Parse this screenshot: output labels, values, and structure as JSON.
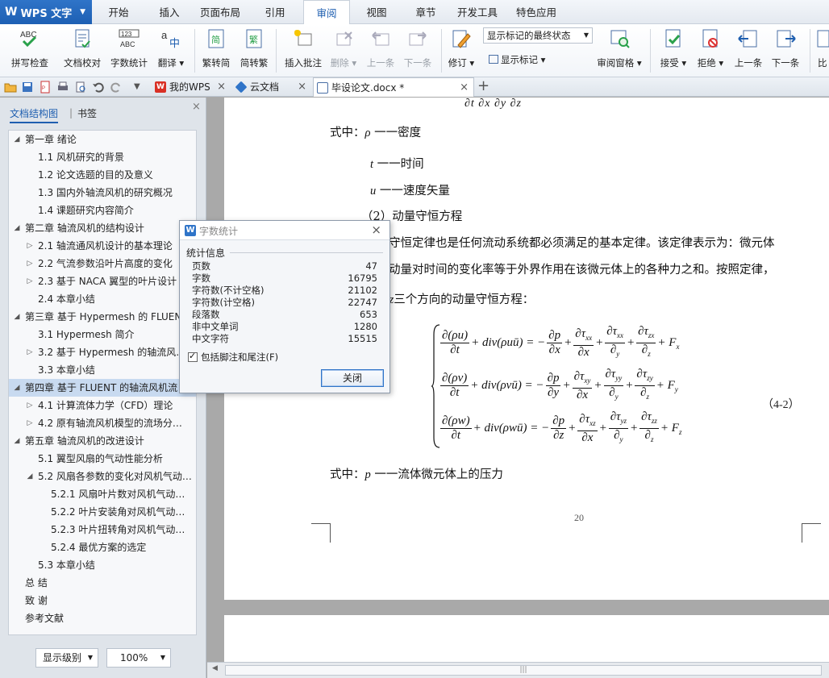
{
  "app": {
    "name": "WPS 文字"
  },
  "menu": {
    "tabs": [
      "开始",
      "插入",
      "页面布局",
      "引用",
      "审阅",
      "视图",
      "章节",
      "开发工具",
      "特色应用"
    ],
    "active": "审阅"
  },
  "ribbon": {
    "spell": "拼写检查",
    "proof": "文档校对",
    "wordcount": "字数统计",
    "translate": "翻译",
    "t2s": "繁转简",
    "s2t": "简转繁",
    "insert_comment": "插入批注",
    "delete": "删除",
    "prev": "上一条",
    "next": "下一条",
    "revise": "修订",
    "track_select": "显示标记的最终状态",
    "show_markup": "显示标记",
    "review_pane": "审阅窗格",
    "accept": "接受",
    "reject": "拒绝",
    "prev2": "上一条",
    "next2": "下一条",
    "compare": "比"
  },
  "tabs_bar": {
    "tab1": "我的WPS",
    "tab2": "云文档",
    "tab3": "毕设论文.docx *"
  },
  "nav": {
    "tab_outline": "文档结构图",
    "tab_bookmark": "书签",
    "items": [
      {
        "text": "第一章  绪论",
        "level": 0,
        "arrow": "◢"
      },
      {
        "text": "1.1 风机研究的背景",
        "level": 1,
        "arrow": ""
      },
      {
        "text": "1.2 论文选题的目的及意义",
        "level": 1,
        "arrow": ""
      },
      {
        "text": "1.3 国内外轴流风机的研究概况",
        "level": 1,
        "arrow": ""
      },
      {
        "text": "1.4 课题研究内容简介",
        "level": 1,
        "arrow": ""
      },
      {
        "text": "第二章  轴流风机的结构设计",
        "level": 0,
        "arrow": "◢"
      },
      {
        "text": "2.1 轴流通风机设计的基本理论",
        "level": 1,
        "arrow": "▷"
      },
      {
        "text": "2.2 气流参数沿叶片高度的变化",
        "level": 1,
        "arrow": "▷"
      },
      {
        "text": "2.3 基于 NACA 翼型的叶片设计",
        "level": 1,
        "arrow": "▷"
      },
      {
        "text": "2.4 本章小结",
        "level": 1,
        "arrow": ""
      },
      {
        "text": "第三章  基于 Hypermesh 的 FLUENT",
        "level": 0,
        "arrow": "◢"
      },
      {
        "text": "3.1 Hypermesh 简介",
        "level": 1,
        "arrow": ""
      },
      {
        "text": "3.2  基于 Hypermesh 的轴流风…",
        "level": 1,
        "arrow": "▷"
      },
      {
        "text": "3.3  本章小结",
        "level": 1,
        "arrow": ""
      },
      {
        "text": "第四章  基于 FLUENT 的轴流风机流",
        "level": 0,
        "arrow": "◢",
        "selected": true
      },
      {
        "text": "4.1  计算流体力学（CFD）理论",
        "level": 1,
        "arrow": "▷"
      },
      {
        "text": "4.2  原有轴流风机模型的流场分…",
        "level": 1,
        "arrow": "▷"
      },
      {
        "text": "第五章  轴流风机的改进设计",
        "level": 0,
        "arrow": "◢"
      },
      {
        "text": "5.1 翼型风扇的气动性能分析",
        "level": 1,
        "arrow": ""
      },
      {
        "text": "5.2 风扇各参数的变化对风机气动…",
        "level": 1,
        "arrow": "◢"
      },
      {
        "text": "5.2.1 风扇叶片数对风机气动性…",
        "level": 2,
        "arrow": ""
      },
      {
        "text": "5.2.2 叶片安装角对风机气动性…",
        "level": 2,
        "arrow": ""
      },
      {
        "text": "5.2.3 叶片扭转角对风机气动性…",
        "level": 2,
        "arrow": ""
      },
      {
        "text": "5.2.4 最优方案的选定",
        "level": 2,
        "arrow": ""
      },
      {
        "text": "5.3 本章小结",
        "level": 1,
        "arrow": ""
      },
      {
        "text": "总  结",
        "level": 0,
        "arrow": ""
      },
      {
        "text": "致  谢",
        "level": 0,
        "arrow": ""
      },
      {
        "text": "参考文献",
        "level": 0,
        "arrow": ""
      }
    ],
    "show_level": "显示级别",
    "zoom": "100%"
  },
  "doc": {
    "top_partial": "∂t        ∂x        ∂y        ∂z",
    "line_rho_pre": "式中：",
    "rho_sym": "ρ",
    "rho_desc": " 一一密度",
    "t_sym": "t",
    "t_desc": " 一一时间",
    "u_sym": "u",
    "u_desc": " 一一速度矢量",
    "heading2": "（2）动量守恒方程",
    "para1": "守恒定律也是任何流动系统都必须满足的基本定律。该定律表示为：微元体",
    "para2": "动量对时间的变化率等于外界作用在该微元体上的各种力之和。按照定律，",
    "para3_sym": "z",
    "para3": "三个方向的动量守恒方程：",
    "eq_no": "（4-2）",
    "p_pre": "式中：",
    "p_sym": "p",
    "p_desc": " 一一流体微元体上的压力",
    "page_number": "20"
  },
  "dialog": {
    "title": "字数统计",
    "group": "统计信息",
    "stats": [
      {
        "k": "页数",
        "v": "47"
      },
      {
        "k": "字数",
        "v": "16795"
      },
      {
        "k": "字符数(不计空格)",
        "v": "21102"
      },
      {
        "k": "字符数(计空格)",
        "v": "22747"
      },
      {
        "k": "段落数",
        "v": "653"
      },
      {
        "k": "非中文单词",
        "v": "1280"
      },
      {
        "k": "中文字符",
        "v": "15515"
      }
    ],
    "checkbox": "包括脚注和尾注(F)",
    "close_btn": "关闭"
  },
  "colors": {
    "accent": "#1f5fb0",
    "brand": "#2f74c8",
    "selection": "#c8daf0"
  }
}
